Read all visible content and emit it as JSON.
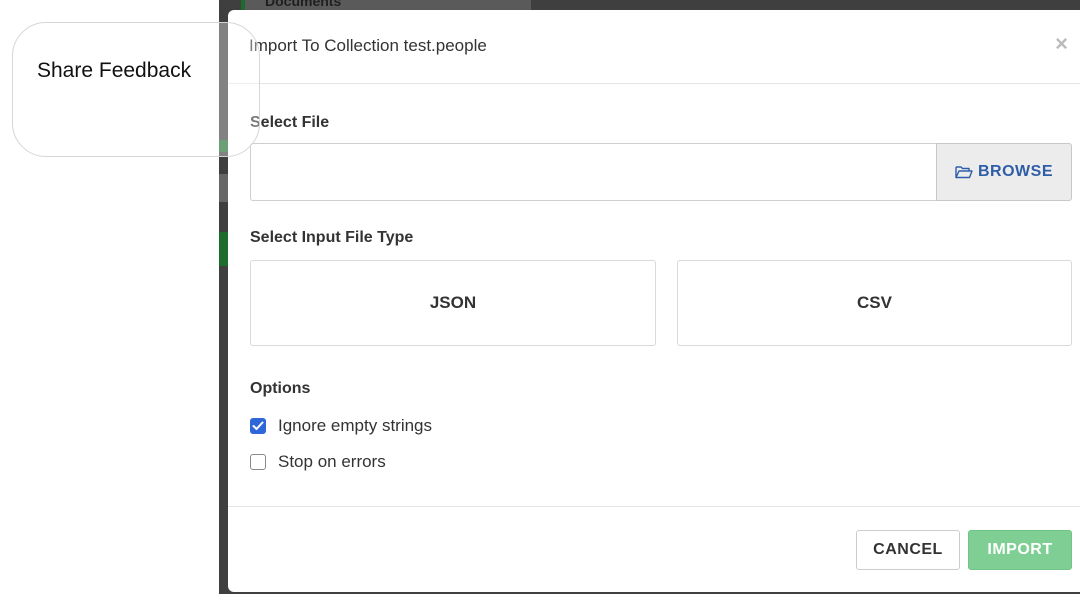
{
  "background": {
    "tab_label": "Documents"
  },
  "modal": {
    "title": "Import To Collection test.people",
    "close_label": "×",
    "select_file": {
      "label": "Select File",
      "input_value": "",
      "browse_label": "BROWSE"
    },
    "file_type": {
      "label": "Select Input File Type",
      "options": [
        "JSON",
        "CSV"
      ]
    },
    "options": {
      "label": "Options",
      "items": [
        {
          "label": "Ignore empty strings",
          "checked": true
        },
        {
          "label": "Stop on errors",
          "checked": false
        }
      ]
    },
    "footer": {
      "cancel_label": "CANCEL",
      "import_label": "IMPORT"
    }
  },
  "feedback": {
    "label": "Share Feedback"
  },
  "colors": {
    "accent_blue": "#2f67d8",
    "browse_text": "#2f5ea8",
    "import_green": "#7fcf94"
  },
  "icons": [
    "folder-open-icon",
    "close-icon",
    "checkmark-icon"
  ]
}
